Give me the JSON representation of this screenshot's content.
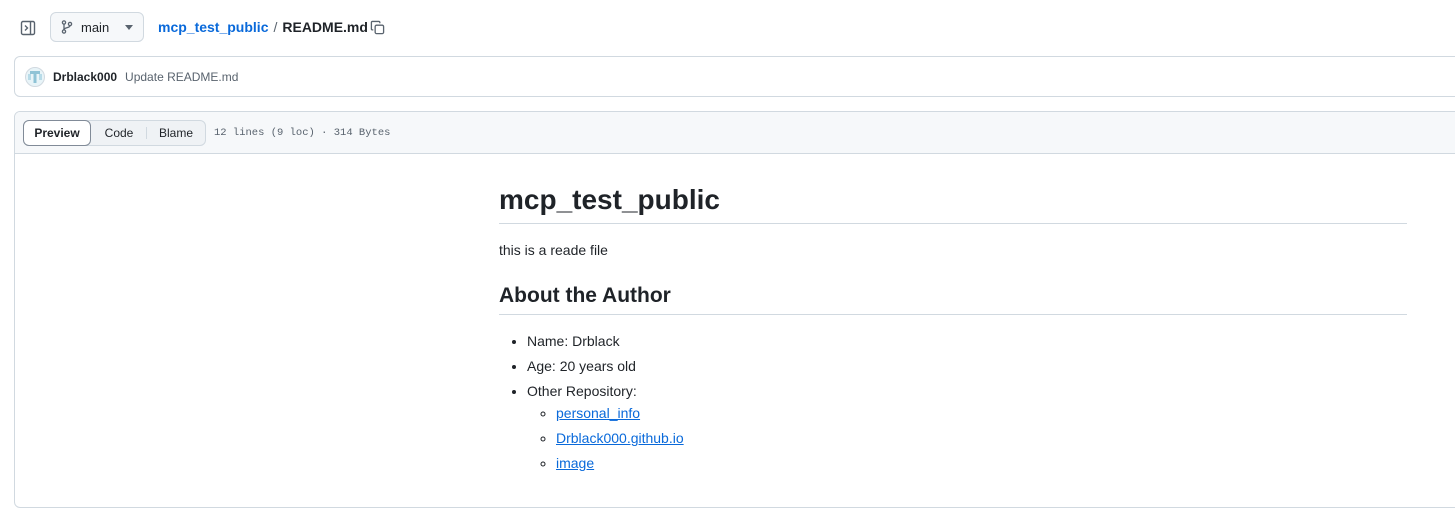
{
  "toolbar": {
    "sidebar_toggle_icon": "sidebar-expand-icon",
    "branch": "main",
    "branch_icon": "git-branch-icon",
    "caret_icon": "triangle-down-icon",
    "repo_name": "mcp_test_public",
    "separator": "/",
    "file_name": "README.md",
    "copy_icon": "copy-icon"
  },
  "commit": {
    "author": "Drblack000",
    "message": "Update README.md"
  },
  "file_header": {
    "tabs": [
      "Preview",
      "Code",
      "Blame"
    ],
    "active_tab": "Preview",
    "meta": "12 lines (9 loc) · 314 Bytes"
  },
  "readme": {
    "title": "mcp_test_public",
    "intro": "this is a reade file",
    "section_title": "About the Author",
    "items": [
      "Name: Drblack",
      "Age: 20 years old",
      "Other Repository:"
    ],
    "links": [
      "personal_info",
      "Drblack000.github.io",
      "image"
    ]
  },
  "colors": {
    "link": "#0969da",
    "border": "#d1d9e0",
    "header_bg": "#f6f8fa",
    "text": "#1f2328",
    "muted": "#59636e"
  }
}
